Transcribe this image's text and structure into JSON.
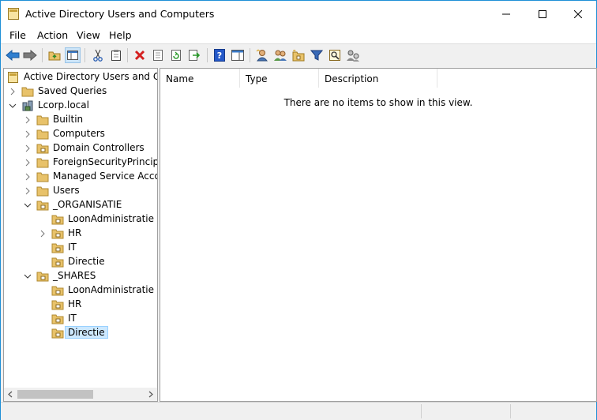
{
  "window": {
    "title": "Active Directory Users and Computers"
  },
  "menu": {
    "items": [
      "File",
      "Action",
      "View",
      "Help"
    ]
  },
  "toolbar": {
    "buttons": [
      "back-arrow-icon",
      "forward-arrow-icon",
      "up-folder-icon",
      "show-hide-tree-icon",
      "cut-icon",
      "copy-icon",
      "delete-icon",
      "properties-icon",
      "refresh-icon",
      "export-list-icon",
      "help-icon",
      "action-pane-icon",
      "new-user-icon",
      "new-group-icon",
      "new-ou-icon",
      "filter-icon",
      "find-icon",
      "delegate-icon"
    ]
  },
  "tree": {
    "root": "Active Directory Users and Com",
    "saved_queries": "Saved Queries",
    "domain": "Lcorp.local",
    "builtin": "Builtin",
    "computers": "Computers",
    "domain_controllers": "Domain Controllers",
    "foreign": "ForeignSecurityPrincipals",
    "managed": "Managed Service Accour",
    "users": "Users",
    "org": "_ORGANISATIE",
    "org_loon": "LoonAdministratie",
    "org_hr": "HR",
    "org_it": "IT",
    "org_directie": "Directie",
    "shares": "_SHARES",
    "shares_loon": "LoonAdministratie",
    "shares_hr": "HR",
    "shares_it": "IT",
    "shares_directie": "Directie"
  },
  "list": {
    "columns": [
      "Name",
      "Type",
      "Description"
    ],
    "empty_message": "There are no items to show in this view."
  },
  "colors": {
    "accent": "#1f8fd6",
    "selection": "#cce8ff",
    "folder": "#e8c26a",
    "ou_folder": "#dcb24a"
  }
}
